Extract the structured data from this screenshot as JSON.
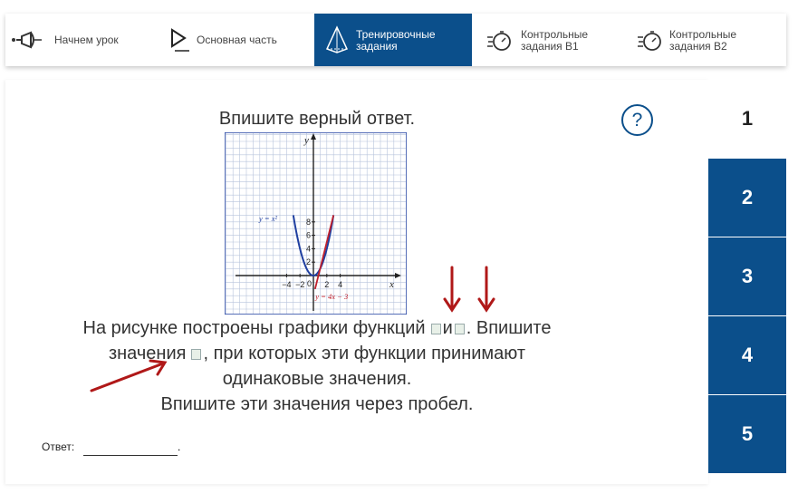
{
  "nav": {
    "items": [
      {
        "label": "Начнем урок",
        "icon": "megaphone-icon"
      },
      {
        "label": "Основная часть",
        "icon": "play-icon"
      },
      {
        "label": "Тренировочные задания",
        "icon": "pyramid-icon",
        "active": true
      },
      {
        "label": "Контрольные задания В1",
        "icon": "stopwatch-icon"
      },
      {
        "label": "Контрольные задания В2",
        "icon": "stopwatch-icon"
      }
    ]
  },
  "task": {
    "title": "Впишите верный ответ.",
    "line1a": "На рисунке построены графики функций",
    "line1b": "и",
    "line1c": ". Впишите",
    "line2a": "значения",
    "line2b": ", при которых эти функции принимают",
    "line3": "одинаковые значения.",
    "line4": "Впишите эти значения через пробел.",
    "answer_label": "Ответ:",
    "answer_value": "",
    "answer_suffix": "."
  },
  "help": {
    "symbol": "?"
  },
  "questions": [
    "1",
    "2",
    "3",
    "4",
    "5"
  ],
  "graph": {
    "xlabel": "x",
    "ylabel": "y",
    "x_ticks": [
      "−4",
      "−2",
      "2",
      "4"
    ],
    "y_ticks": [
      "2",
      "4",
      "6",
      "8"
    ],
    "origin": "0",
    "parabola_label": "y = x²",
    "line_label": "y = 4x − 3",
    "colors": {
      "parabola": "#1f3fa0",
      "line": "#c0202c",
      "accent": "#0b4f8b"
    }
  }
}
